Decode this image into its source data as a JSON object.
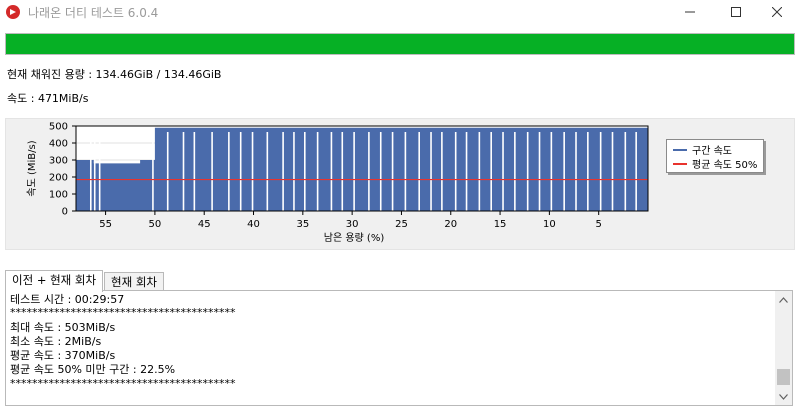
{
  "window": {
    "title": "나래온 더티 테스트 6.0.4",
    "minimize_icon": "minimize-icon",
    "maximize_icon": "maximize-icon",
    "close_icon": "close-icon"
  },
  "progress": {
    "value_percent": 100,
    "color": "#06b025"
  },
  "status": {
    "filled_capacity": "현재 채워진 용량 : 134.46GiB / 134.46GiB",
    "speed": "속도 : 471MiB/s"
  },
  "chart_data": {
    "type": "area",
    "ylabel": "속도 (MiB/s)",
    "xlabel": "남은 용량 (%)",
    "ylim": [
      0,
      500
    ],
    "xlim": [
      58,
      0
    ],
    "x_reversed": true,
    "y_ticks": [
      "500",
      "400",
      "300",
      "200",
      "100",
      "0"
    ],
    "x_ticks": [
      "55",
      "50",
      "45",
      "40",
      "35",
      "30",
      "25",
      "20",
      "15",
      "10",
      "5"
    ],
    "grid": true,
    "legend_position": "right",
    "series": [
      {
        "name": "구간 속도",
        "color": "#4a6bab",
        "description_values": "mostly 480-500 MiB/s with periodic drops to ~0-10 MiB/s; ~270-300 MiB/s from 58% to 50% remaining",
        "segments": [
          {
            "x_from": 58,
            "x_to": 56.2,
            "y": 300
          },
          {
            "x_from": 56.2,
            "x_to": 51.5,
            "y": 280
          },
          {
            "x_from": 51.5,
            "x_to": 50.0,
            "y": 300
          },
          {
            "x_from": 50.0,
            "x_to": 0,
            "y": 490
          }
        ],
        "drops_x": [
          56.5,
          56.1,
          55.6,
          50.2,
          48.7,
          47.1,
          46.0,
          44.2,
          42.5,
          41.3,
          40.1,
          38.6,
          37.0,
          35.9,
          34.8,
          33.5,
          32.1,
          31.0,
          29.8,
          28.3,
          27.1,
          25.9,
          24.6,
          23.2,
          22.0,
          20.9,
          19.5,
          18.4,
          17.1,
          15.9,
          14.7,
          13.5,
          12.2,
          11.0,
          9.8,
          8.5,
          7.3,
          6.1,
          4.8,
          3.6,
          2.3,
          1.2
        ]
      },
      {
        "name": "평균 속도 50%",
        "color": "#e8332d",
        "values": [
          185
        ]
      }
    ]
  },
  "tabs": [
    {
      "label": "이전 + 현재 회차",
      "active": true
    },
    {
      "label": "현재 회차",
      "active": false
    }
  ],
  "log": [
    "테스트 시간 : 00:29:57",
    "*****************************************",
    "최대 속도 : 503MiB/s",
    "최소 속도 : 2MiB/s",
    "평균 속도 : 370MiB/s",
    "평균 속도 50% 미만 구간 : 22.5%",
    "*****************************************"
  ]
}
